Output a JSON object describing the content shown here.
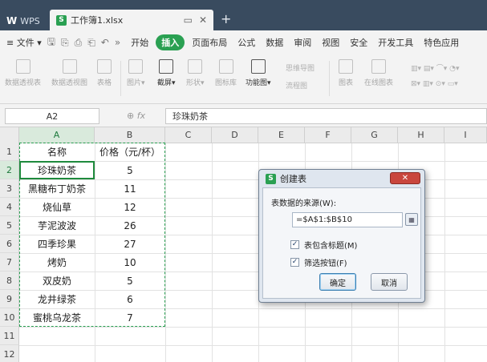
{
  "app": {
    "tabs": [
      {
        "label": "WPS",
        "icon": "wps-logo-icon"
      },
      {
        "label": "工作簿1.xlsx",
        "icon": "spreadsheet-logo-icon"
      }
    ],
    "tab_controls": {
      "restore": "▭",
      "close": "✕"
    },
    "new_tab": "+"
  },
  "menu": {
    "file_label": "≡ 文件 ▾",
    "quick_access": [
      "save-icon",
      "export-pdf-icon",
      "print-icon",
      "print-preview-icon",
      "undo-icon",
      "more-icon"
    ],
    "quick_access_glyphs": [
      "🖫",
      "⎘",
      "⎙",
      "⎗",
      "↶",
      "»"
    ],
    "tabs": [
      "开始",
      "插入",
      "页面布局",
      "公式",
      "数据",
      "审阅",
      "视图",
      "安全",
      "开发工具",
      "特色应用"
    ],
    "active_tab": "插入",
    "accent_color": "#2aa052"
  },
  "ribbon": {
    "buttons": [
      "数据透视表",
      "数据透视图",
      "表格",
      "图片▾",
      "截屏▾",
      "形状▾",
      "图标库",
      "功能图▾"
    ],
    "extras": [
      "思维导图",
      "流程图",
      "图表",
      "在线图表"
    ]
  },
  "formula_bar": {
    "cell_ref": "A2",
    "fx_label": "fx",
    "content": "珍珠奶茶"
  },
  "sheet": {
    "columns": [
      "A",
      "B",
      "C",
      "D",
      "E",
      "F",
      "G",
      "H",
      "I"
    ],
    "rows": [
      "1",
      "2",
      "3",
      "4",
      "5",
      "6",
      "7",
      "8",
      "9",
      "10",
      "11",
      "12"
    ],
    "header": {
      "a": "名称",
      "b": "价格（元/杯）"
    },
    "data": [
      {
        "name": "珍珠奶茶",
        "price": "5"
      },
      {
        "name": "黑糖布丁奶茶",
        "price": "11"
      },
      {
        "name": "烧仙草",
        "price": "12"
      },
      {
        "name": "芋泥波波",
        "price": "26"
      },
      {
        "name": "四季珍果",
        "price": "27"
      },
      {
        "name": "烤奶",
        "price": "10"
      },
      {
        "name": "双皮奶",
        "price": "5"
      },
      {
        "name": "龙井绿茶",
        "price": "6"
      },
      {
        "name": "蜜桃乌龙茶",
        "price": "7"
      }
    ],
    "selected_cell": "A2"
  },
  "dialog": {
    "title": "创建表",
    "source_label": "表数据的来源(W):",
    "range": "=$A$1:$B$10",
    "checkboxes": [
      {
        "label": "表包含标题(M)",
        "checked": true
      },
      {
        "label": "筛选按钮(F)",
        "checked": true
      }
    ],
    "check_mark": "✓",
    "ok_label": "确定",
    "cancel_label": "取消",
    "close_label": "✕"
  }
}
